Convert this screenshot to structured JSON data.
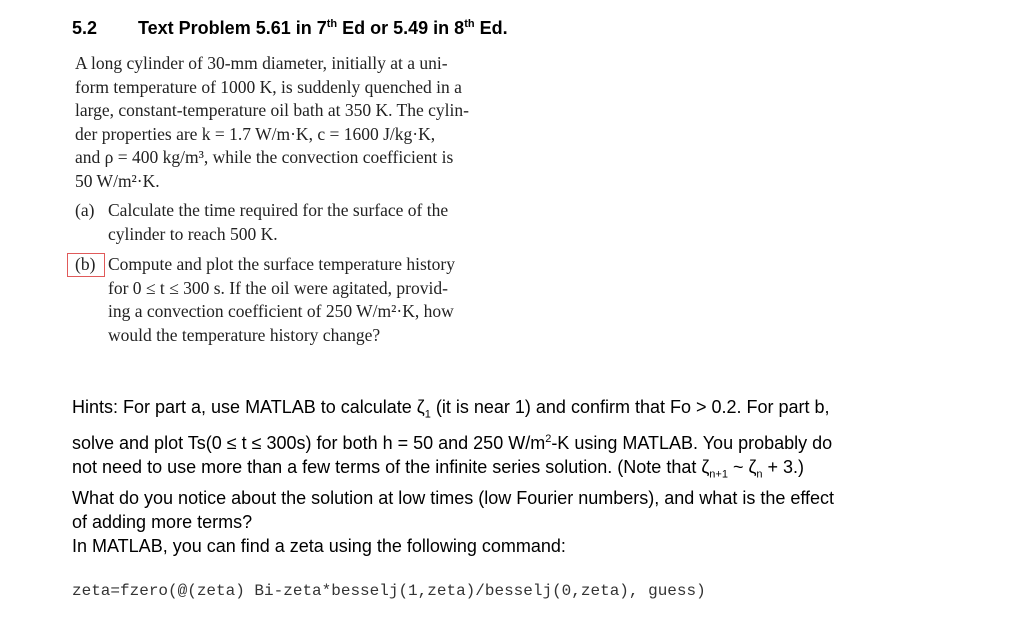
{
  "heading": {
    "number": "5.2",
    "title_pre": "Text Problem 5.61 in 7",
    "sup1": "th",
    "title_mid": " Ed or 5.49 in 8",
    "sup2": "th",
    "title_post": " Ed."
  },
  "problem": {
    "lines": [
      "A long cylinder of 30-mm diameter, initially at a uni-",
      "form temperature of 1000 K, is suddenly quenched in a",
      "large, constant-temperature oil bath at 350 K. The cylin-",
      "der properties are k = 1.7 W/m·K, c = 1600 J/kg·K,",
      "and ρ = 400 kg/m³, while the convection coefficient is",
      "50 W/m²·K."
    ],
    "part_a": {
      "label": "(a)",
      "lines": [
        "Calculate the time required for the surface of the",
        "cylinder to reach 500 K."
      ]
    },
    "part_b": {
      "label": "(b)",
      "lines": [
        "Compute and plot the surface temperature history",
        "for 0 ≤ t ≤ 300 s. If the oil were agitated, provid-",
        "ing a convection coefficient of 250 W/m²·K, how",
        "would the temperature history change?"
      ]
    }
  },
  "hints": {
    "l1_a": "Hints: For part a, use MATLAB to calculate ζ",
    "l1_sub": "1",
    "l1_b": " (it is near 1) and confirm that Fo > 0.2.  For part b,",
    "l2_a": "solve and plot Ts(0 ≤ t ≤ 300s) for both h = 50 and 250 W/m",
    "l2_sup": "2",
    "l2_b": "-K using MATLAB.  You probably do",
    "l3_a": "not need to use more than a few terms of the infinite series solution.  (Note that ζ",
    "l3_sub1": "n+1",
    "l3_b": " ~ ζ",
    "l3_sub2": "n",
    "l3_c": " + 3.)",
    "l4": "What do you notice about the solution at low times (low Fourier numbers), and what is the effect",
    "l5": "of adding more terms?"
  },
  "matlab_note": "In MATLAB, you can find a zeta using the following command:",
  "code": "zeta=fzero(@(zeta) Bi-zeta*besselj(1,zeta)/besselj(0,zeta), guess)"
}
